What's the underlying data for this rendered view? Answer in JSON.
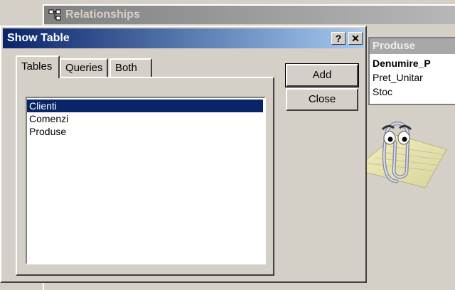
{
  "relationships_window": {
    "title": "Relationships"
  },
  "produse_table": {
    "title": "Produse",
    "fields": [
      {
        "name": "Denumire_P",
        "primary_key": true
      },
      {
        "name": "Pret_Unitar",
        "primary_key": false
      },
      {
        "name": "Stoc",
        "primary_key": false
      }
    ]
  },
  "show_table_dialog": {
    "title": "Show Table",
    "help_button": "?",
    "close_x_button": "✕",
    "tabs": [
      {
        "label": "Tables",
        "active": true
      },
      {
        "label": "Queries",
        "active": false
      },
      {
        "label": "Both",
        "active": false
      }
    ],
    "list_items": [
      {
        "label": "Clienti",
        "selected": true
      },
      {
        "label": "Comenzi",
        "selected": false
      },
      {
        "label": "Produse",
        "selected": false
      }
    ],
    "buttons": {
      "add": "Add",
      "close": "Close"
    }
  },
  "colors": {
    "dialog_title_start": "#0a246a",
    "dialog_title_end": "#a6caf0",
    "selection": "#0a246a",
    "face": "#d4d0c8"
  },
  "icons": [
    "relationships-icon",
    "office-assistant-clippy-icon"
  ]
}
